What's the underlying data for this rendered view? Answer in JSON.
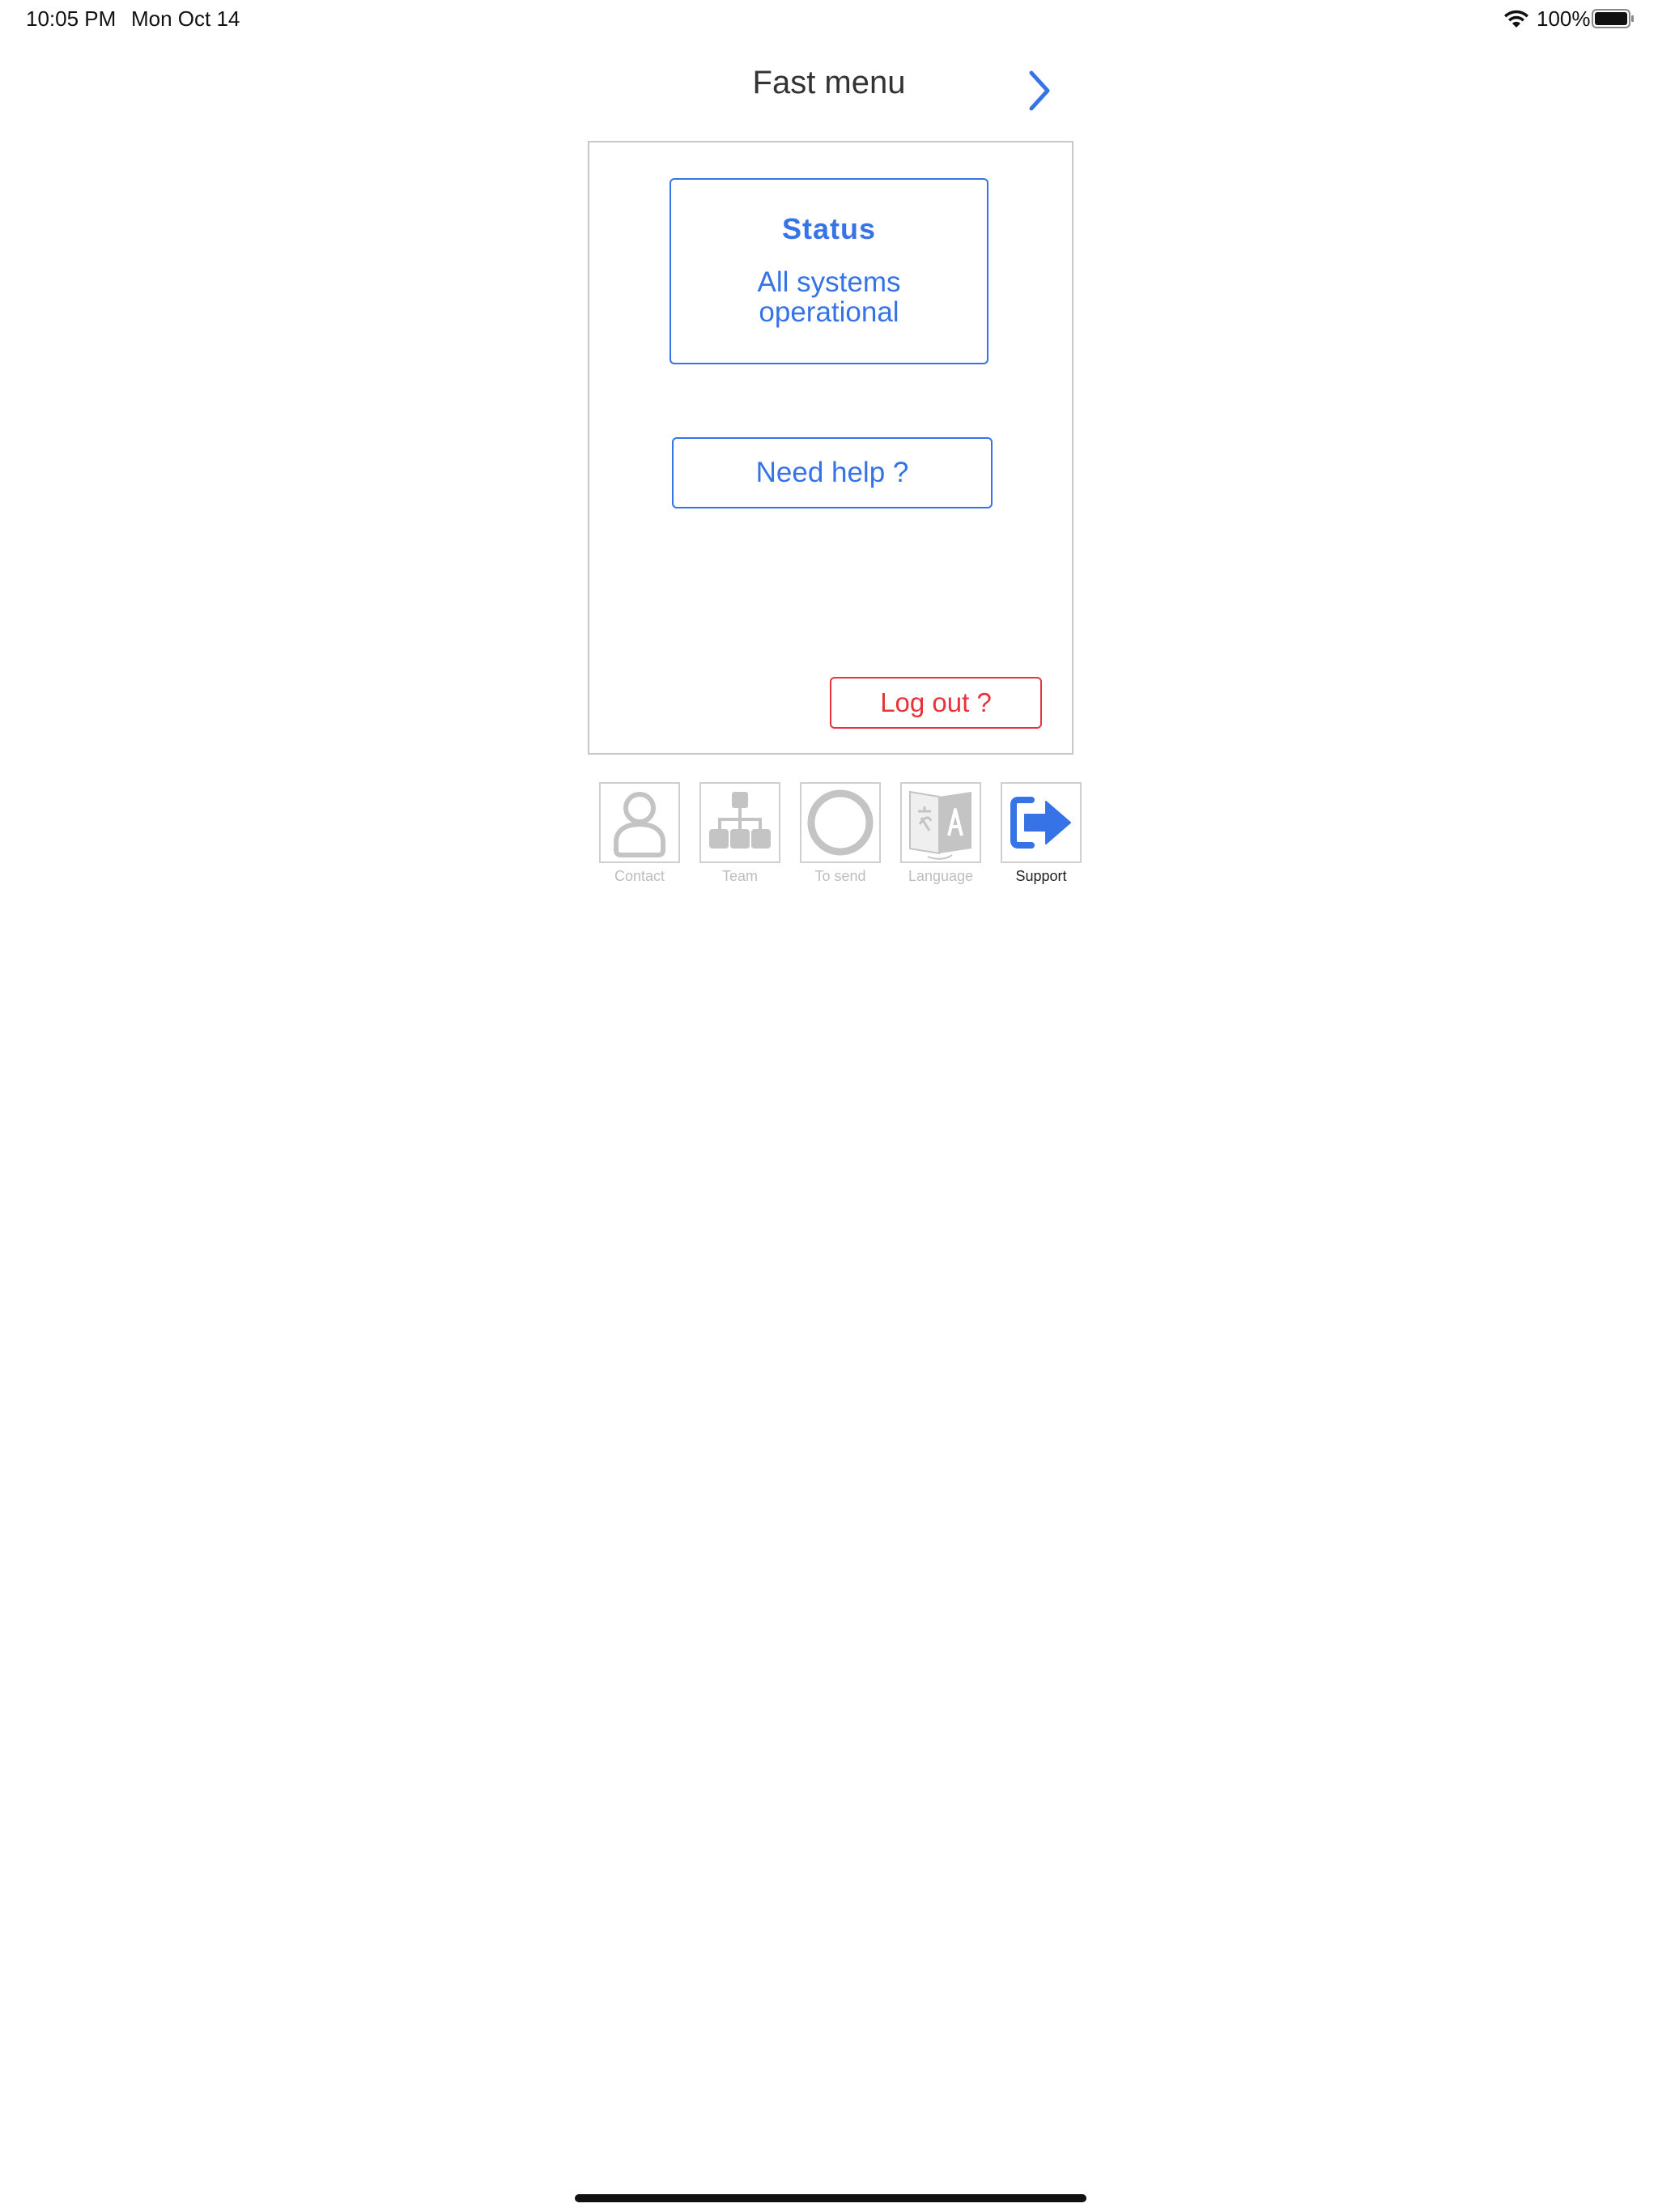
{
  "status_bar": {
    "time": "10:05 PM",
    "date": "Mon Oct 14",
    "battery_percent": "100%",
    "battery_level": 1.0,
    "icons": [
      "wifi-icon",
      "battery-icon"
    ]
  },
  "header": {
    "title": "Fast menu",
    "next_icon": "chevron-right-icon"
  },
  "panel": {
    "status_card": {
      "title": "Status",
      "text": "All systems operational"
    },
    "help_button": "Need help ?",
    "logout_button": "Log out ?"
  },
  "tabs": [
    {
      "label": "Contact",
      "icon": "person-icon",
      "active": false
    },
    {
      "label": "Team",
      "icon": "org-chart-icon",
      "active": false
    },
    {
      "label": "To send",
      "icon": "ring-icon",
      "active": false
    },
    {
      "label": "Language",
      "icon": "translate-icon",
      "active": false
    },
    {
      "label": "Support",
      "icon": "sign-out-arrow-icon",
      "active": true
    }
  ],
  "colors": {
    "accent": "#3573e6",
    "danger": "#e8323c",
    "inactive_icon": "#c4c4c4",
    "border": "#c8c8c8"
  }
}
